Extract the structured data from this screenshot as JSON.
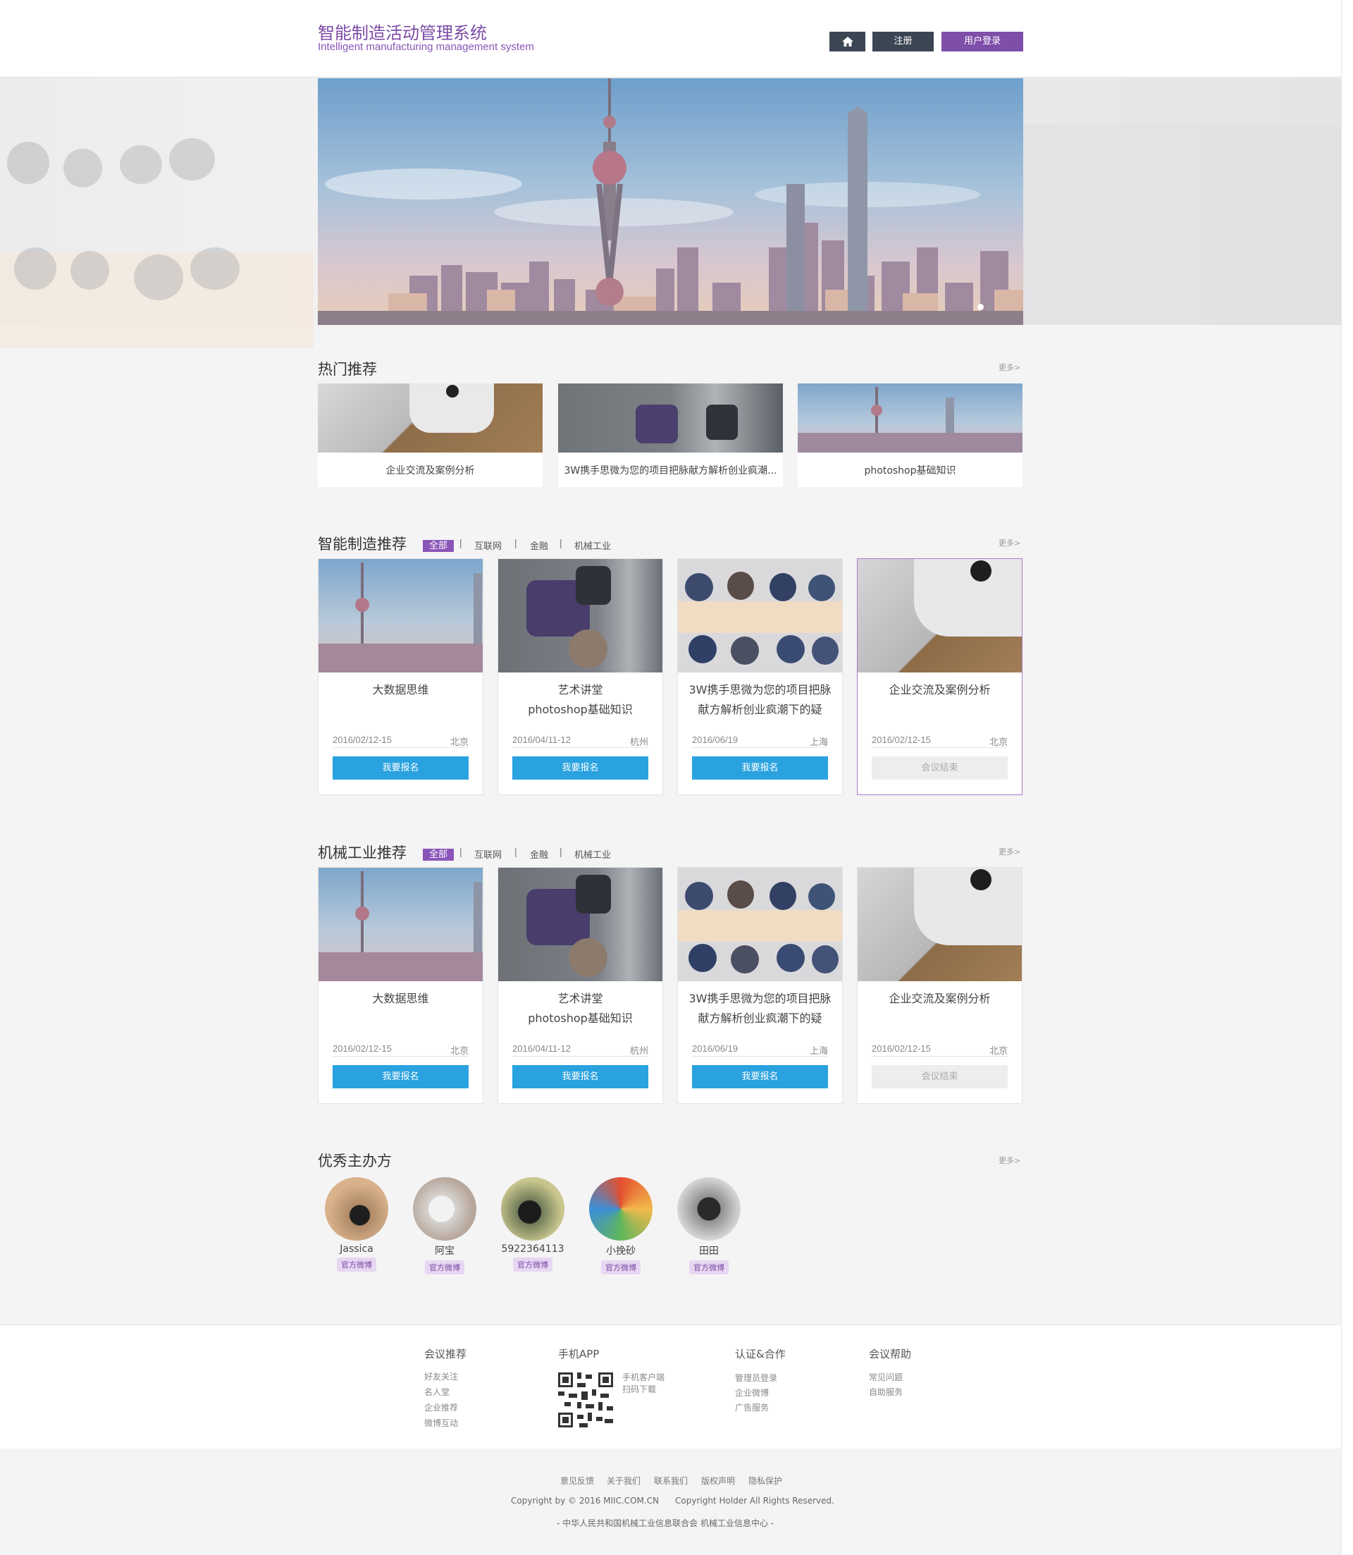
{
  "header": {
    "title_cn": "智能制造活动管理系统",
    "title_en": "Intelligent manufacturing management system",
    "home_icon": "home-icon",
    "register_label": "注册",
    "login_label": "用户登录"
  },
  "banner": {
    "slides": 2,
    "active_slide": 1
  },
  "hot": {
    "title": "热门推荐",
    "more": "更多>",
    "cards": [
      {
        "caption": "企业交流及案例分析",
        "image": "keyboard-computer"
      },
      {
        "caption": "3W携手思微为您的项目把脉献方解析创业疯潮...",
        "image": "business-meeting"
      },
      {
        "caption": "photoshop基础知识",
        "image": "shanghai-skyline"
      }
    ]
  },
  "sections": [
    {
      "title": "智能制造推荐",
      "more": "更多>",
      "filters": [
        "全部",
        "互联网",
        "金融",
        "机械工业"
      ],
      "active_filter": "全部",
      "cards": [
        {
          "title": "大数据思维",
          "date": "2016/02/12-15",
          "city": "北京",
          "button": "我要报名",
          "ended": false,
          "image": "shanghai-skyline"
        },
        {
          "title": "艺术讲堂\nphotoshop基础知识",
          "date": "2016/04/11-12",
          "city": "杭州",
          "button": "我要报名",
          "ended": false,
          "image": "business-meeting"
        },
        {
          "title": "3W携手思微为您的项目把脉献方解析创业疯潮下的疑",
          "date": "2016/06/19",
          "city": "上海",
          "button": "我要报名",
          "ended": false,
          "image": "team-table"
        },
        {
          "title": "企业交流及案例分析",
          "date": "2016/02/12-15",
          "city": "北京",
          "button": "会议结束",
          "ended": true,
          "image": "keyboard-computer"
        }
      ]
    },
    {
      "title": "机械工业推荐",
      "more": "更多>",
      "filters": [
        "全部",
        "互联网",
        "金融",
        "机械工业"
      ],
      "active_filter": "全部",
      "cards": [
        {
          "title": "大数据思维",
          "date": "2016/02/12-15",
          "city": "北京",
          "button": "我要报名",
          "ended": false,
          "image": "shanghai-skyline"
        },
        {
          "title": "艺术讲堂\nphotoshop基础知识",
          "date": "2016/04/11-12",
          "city": "杭州",
          "button": "我要报名",
          "ended": false,
          "image": "business-meeting"
        },
        {
          "title": "3W携手思微为您的项目把脉献方解析创业疯潮下的疑",
          "date": "2016/06/19",
          "city": "上海",
          "button": "我要报名",
          "ended": false,
          "image": "team-table"
        },
        {
          "title": "企业交流及案例分析",
          "date": "2016/02/12-15",
          "city": "北京",
          "button": "会议结束",
          "ended": true,
          "image": "keyboard-computer"
        }
      ]
    }
  ],
  "organizers": {
    "title": "优秀主办方",
    "more": "更多>",
    "items": [
      {
        "name": "Jassica",
        "badge": "官方微博"
      },
      {
        "name": "阿宝",
        "badge": "官方微博"
      },
      {
        "name": "5922364113",
        "badge": "官方微博"
      },
      {
        "name": "小挽砂",
        "badge": "官方微博"
      },
      {
        "name": "田田",
        "badge": "官方微博"
      }
    ]
  },
  "footer": {
    "columns": [
      {
        "title": "会议推荐",
        "links": [
          "好友关注",
          "名人堂",
          "企业推荐",
          "微博互动"
        ]
      },
      {
        "title": "手机APP",
        "links": [
          "手机客户端",
          "扫码下载"
        ]
      },
      {
        "title": "认证&合作",
        "links": [
          "管理员登录",
          "企业微博",
          "广告服务"
        ]
      },
      {
        "title": "会议帮助",
        "links": [
          "常见问题",
          "自助服务"
        ]
      }
    ],
    "bottom_links": [
      "意见反馈",
      "关于我们",
      "联系我们",
      "版权声明",
      "隐私保护"
    ],
    "copyright": "Copyright by © 2016 MIIC.COM.CN",
    "rights": "Copyright Holder All Rights Reserved.",
    "org_line": "-  中华人民共和国机械工业信息联合会    机械工业信息中心  -"
  },
  "colors": {
    "brand": "#7e4ea9",
    "primary_button": "#2aa2df",
    "dark_button": "#3b4653"
  }
}
